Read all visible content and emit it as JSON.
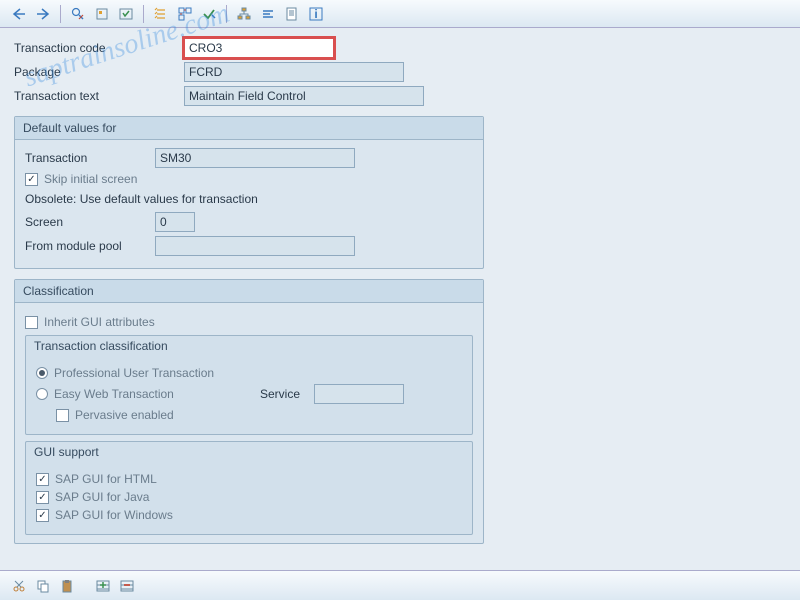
{
  "header": {
    "transaction_code_label": "Transaction code",
    "transaction_code": "CRO3",
    "package_label": "Package",
    "package": "FCRD",
    "transaction_text_label": "Transaction text",
    "transaction_text": "Maintain Field Control"
  },
  "default_values": {
    "title": "Default values for",
    "transaction_label": "Transaction",
    "transaction": "SM30",
    "skip_initial_label": "Skip initial screen",
    "skip_initial_checked": true,
    "obsolete_text": "Obsolete: Use default values for transaction",
    "screen_label": "Screen",
    "screen": "0",
    "from_module_pool_label": "From module pool",
    "from_module_pool": ""
  },
  "classification": {
    "title": "Classification",
    "inherit_label": "Inherit GUI attributes",
    "inherit_checked": false,
    "trans_class": {
      "title": "Transaction classification",
      "professional_label": "Professional User Transaction",
      "professional_selected": true,
      "easy_web_label": "Easy Web Transaction",
      "easy_web_selected": false,
      "service_label": "Service",
      "service_value": "",
      "pervasive_label": "Pervasive enabled",
      "pervasive_checked": false
    },
    "gui_support": {
      "title": "GUI support",
      "html_label": "SAP GUI for HTML",
      "html_checked": true,
      "java_label": "SAP GUI for Java",
      "java_checked": true,
      "windows_label": "SAP GUI for Windows",
      "windows_checked": true
    }
  },
  "watermark": "saptrainsoline.com"
}
